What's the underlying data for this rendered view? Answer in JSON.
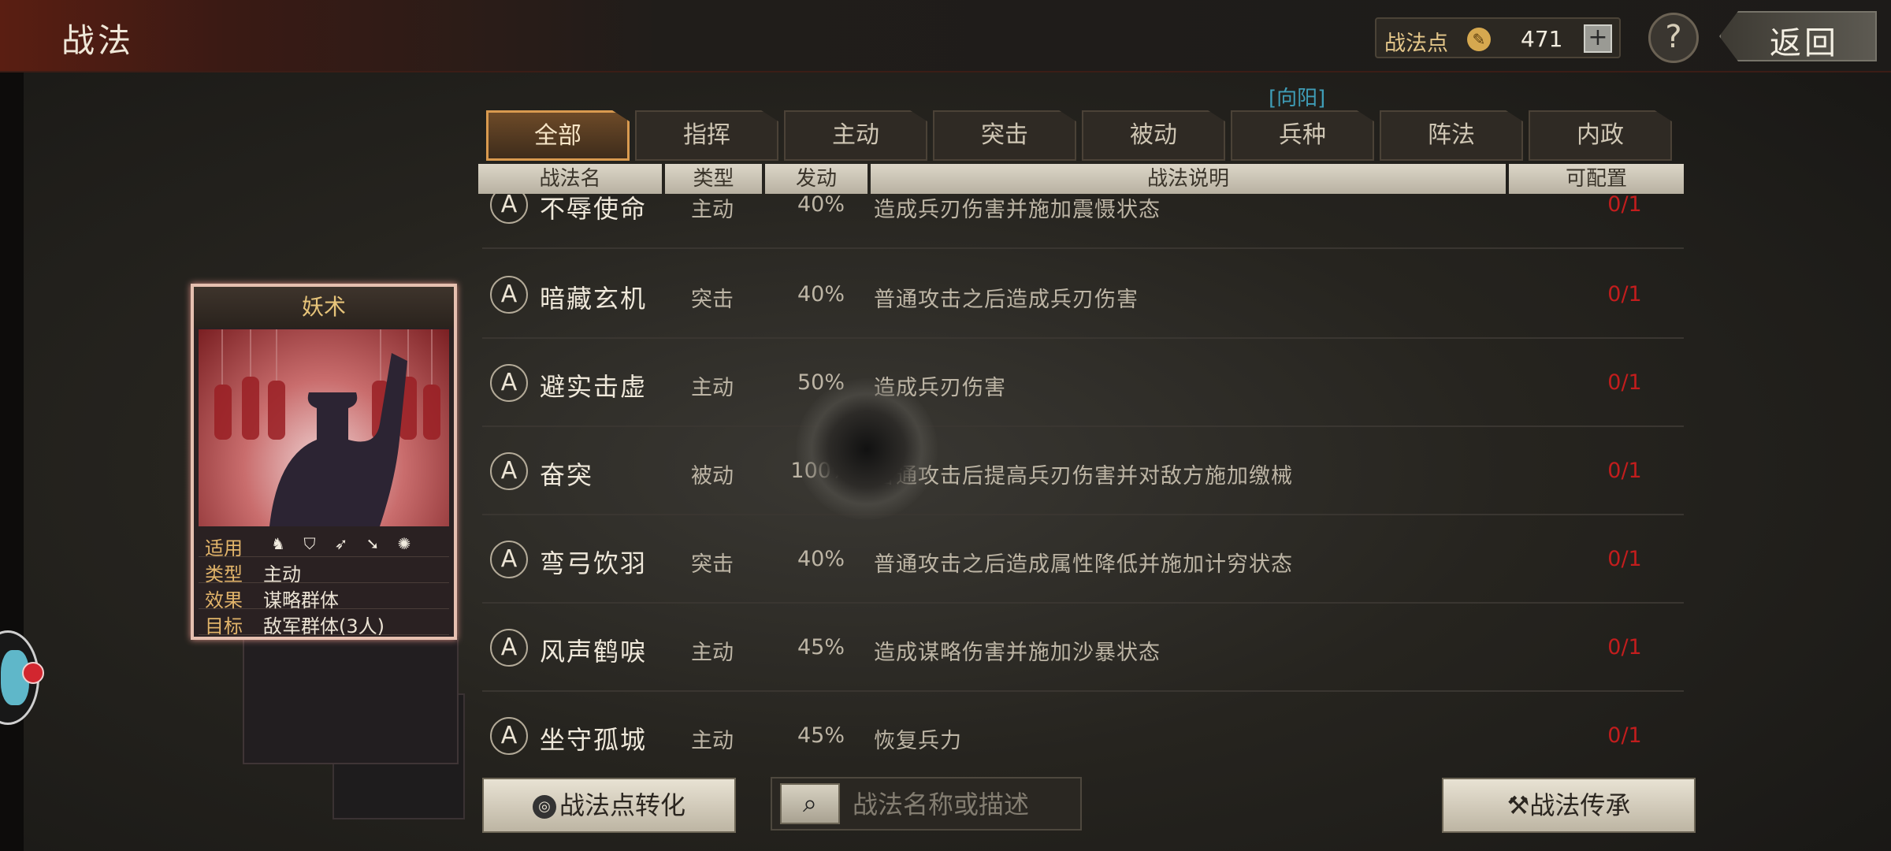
{
  "header": {
    "title": "战法",
    "points_label": "战法点",
    "points_value": "471",
    "plus": "+",
    "help": "?",
    "back": "返回"
  },
  "server_tag": "[向阳]",
  "tabs": [
    {
      "label": "全部",
      "active": true
    },
    {
      "label": "指挥"
    },
    {
      "label": "主动"
    },
    {
      "label": "突击"
    },
    {
      "label": "被动"
    },
    {
      "label": "兵种"
    },
    {
      "label": "阵法"
    },
    {
      "label": "内政"
    }
  ],
  "columns": [
    "战法名",
    "类型",
    "发动",
    "战法说明",
    "可配置"
  ],
  "rows": [
    {
      "grade": "A",
      "name": "不辱使命",
      "type": "主动",
      "rate": "40%",
      "desc": "造成兵刃伤害并施加震慑状态",
      "config": "0/1"
    },
    {
      "grade": "A",
      "name": "暗藏玄机",
      "type": "突击",
      "rate": "40%",
      "desc": "普通攻击之后造成兵刃伤害",
      "config": "0/1"
    },
    {
      "grade": "A",
      "name": "避实击虚",
      "type": "主动",
      "rate": "50%",
      "desc": "造成兵刃伤害",
      "config": "0/1"
    },
    {
      "grade": "A",
      "name": "奋突",
      "type": "被动",
      "rate": "100%",
      "desc": "普通攻击后提高兵刃伤害并对敌方施加缴械",
      "config": "0/1"
    },
    {
      "grade": "A",
      "name": "弯弓饮羽",
      "type": "突击",
      "rate": "40%",
      "desc": "普通攻击之后造成属性降低并施加计穷状态",
      "config": "0/1"
    },
    {
      "grade": "A",
      "name": "风声鹤唳",
      "type": "主动",
      "rate": "45%",
      "desc": "造成谋略伤害并施加沙暴状态",
      "config": "0/1"
    },
    {
      "grade": "A",
      "name": "坐守孤城",
      "type": "主动",
      "rate": "45%",
      "desc": "恢复兵力",
      "config": "0/1"
    }
  ],
  "card": {
    "title": "妖术",
    "stats": [
      {
        "key": "适用",
        "value": ""
      },
      {
        "key": "类型",
        "value": "主动"
      },
      {
        "key": "效果",
        "value": "谋略群体"
      },
      {
        "key": "目标",
        "value": "敌军群体(3人)"
      }
    ],
    "unit_icons": [
      "cavalry-icon",
      "shield-icon",
      "bow-icon",
      "spear-icon",
      "siege-icon"
    ]
  },
  "bottom": {
    "convert_label": "战法点转化",
    "search_placeholder": "战法名称或描述",
    "inherit_label": "战法传承"
  },
  "colors": {
    "accent_gold": "#e7c47a",
    "config_red": "#c21d1d",
    "tab_active_border": "#d99a4f",
    "server_tag": "#3f9db7"
  }
}
